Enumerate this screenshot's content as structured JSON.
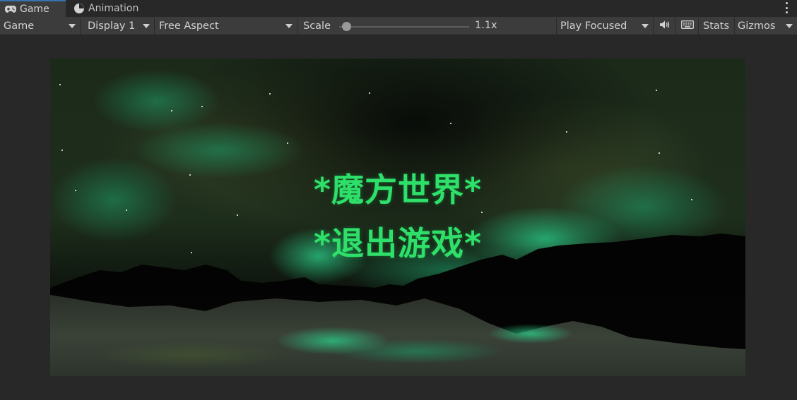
{
  "tabs": [
    {
      "label": "Game",
      "icon": "gamepad-icon",
      "active": true
    },
    {
      "label": "Animation",
      "icon": "animation-clock-icon",
      "active": false
    }
  ],
  "toolbar": {
    "view_mode": "Game",
    "display": "Display 1",
    "aspect": "Free Aspect",
    "scale_label": "Scale",
    "scale_value": "1.1x",
    "scale_fraction": 0.04,
    "play_mode": "Play Focused",
    "stats_label": "Stats",
    "gizmos_label": "Gizmos"
  },
  "game": {
    "menu": {
      "start": "*魔方世界*",
      "quit": "*退出游戏*"
    },
    "text_color": "#2ee06a"
  },
  "colors": {
    "accent": "#3a72b0",
    "toolbar_bg": "#3c3c3c",
    "panel_bg": "#282828"
  }
}
